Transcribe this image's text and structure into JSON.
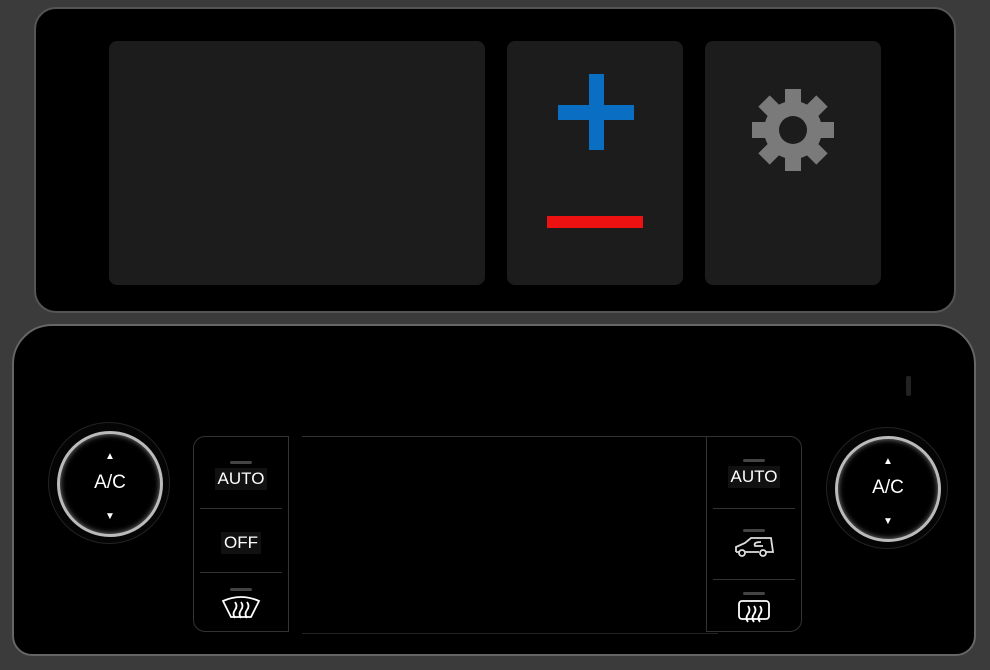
{
  "top_controls": {
    "plus_icon": "plus-icon",
    "minus_icon": "minus-icon",
    "settings_icon": "gear-icon",
    "plus_color": "#0a6fc2",
    "minus_color": "#ee1111"
  },
  "left_knob": {
    "label": "A/C",
    "up": "▲",
    "down": "▼"
  },
  "right_knob": {
    "label": "A/C",
    "up": "▲",
    "down": "▼"
  },
  "left_buttons": {
    "auto": "AUTO",
    "off": "OFF",
    "defrost_icon": "front-defrost-icon"
  },
  "right_buttons": {
    "auto": "AUTO",
    "recirc_icon": "recirculation-icon",
    "defrost_icon": "rear-defrost-icon"
  }
}
